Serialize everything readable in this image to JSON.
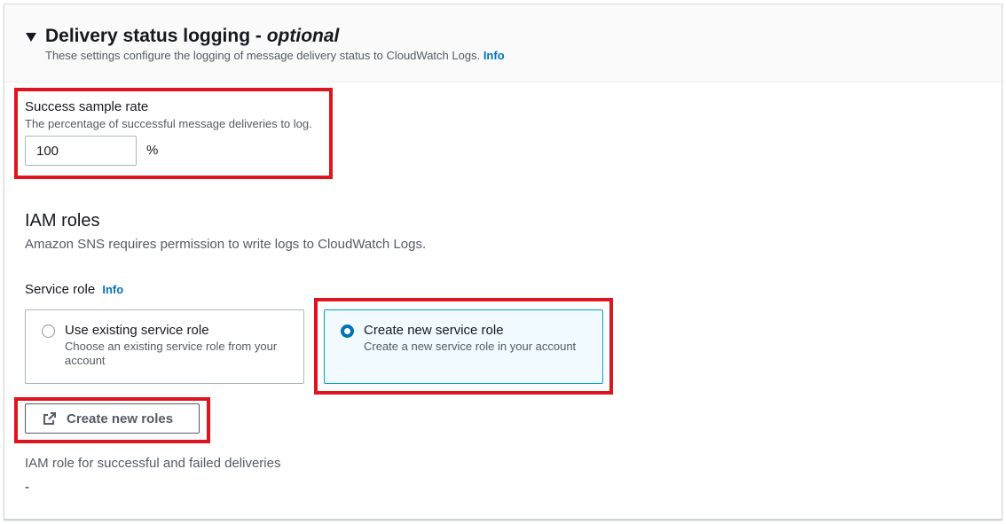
{
  "section": {
    "title": "Delivery status logging - ",
    "title_optional": "optional",
    "description": "These settings configure the logging of message delivery status to CloudWatch Logs.",
    "info_label": "Info"
  },
  "success_sample_rate": {
    "label": "Success sample rate",
    "description": "The percentage of successful message deliveries to log.",
    "value": "100",
    "unit": "%"
  },
  "iam_roles": {
    "title": "IAM roles",
    "description": "Amazon SNS requires permission to write logs to CloudWatch Logs."
  },
  "service_role": {
    "label": "Service role",
    "info_label": "Info",
    "options": [
      {
        "title": "Use existing service role",
        "description": "Choose an existing service role from your account",
        "selected": false
      },
      {
        "title": "Create new service role",
        "description": "Create a new service role in your account",
        "selected": true
      }
    ]
  },
  "create_roles_button": {
    "label": "Create new roles",
    "icon": "external-link-icon"
  },
  "iam_role_deliveries": {
    "label": "IAM role for successful and failed deliveries",
    "value": "-"
  },
  "colors": {
    "highlight": "#e0141e",
    "link": "#0073bb",
    "selected_border": "#00a1c9",
    "selected_bg": "#f1faff"
  }
}
